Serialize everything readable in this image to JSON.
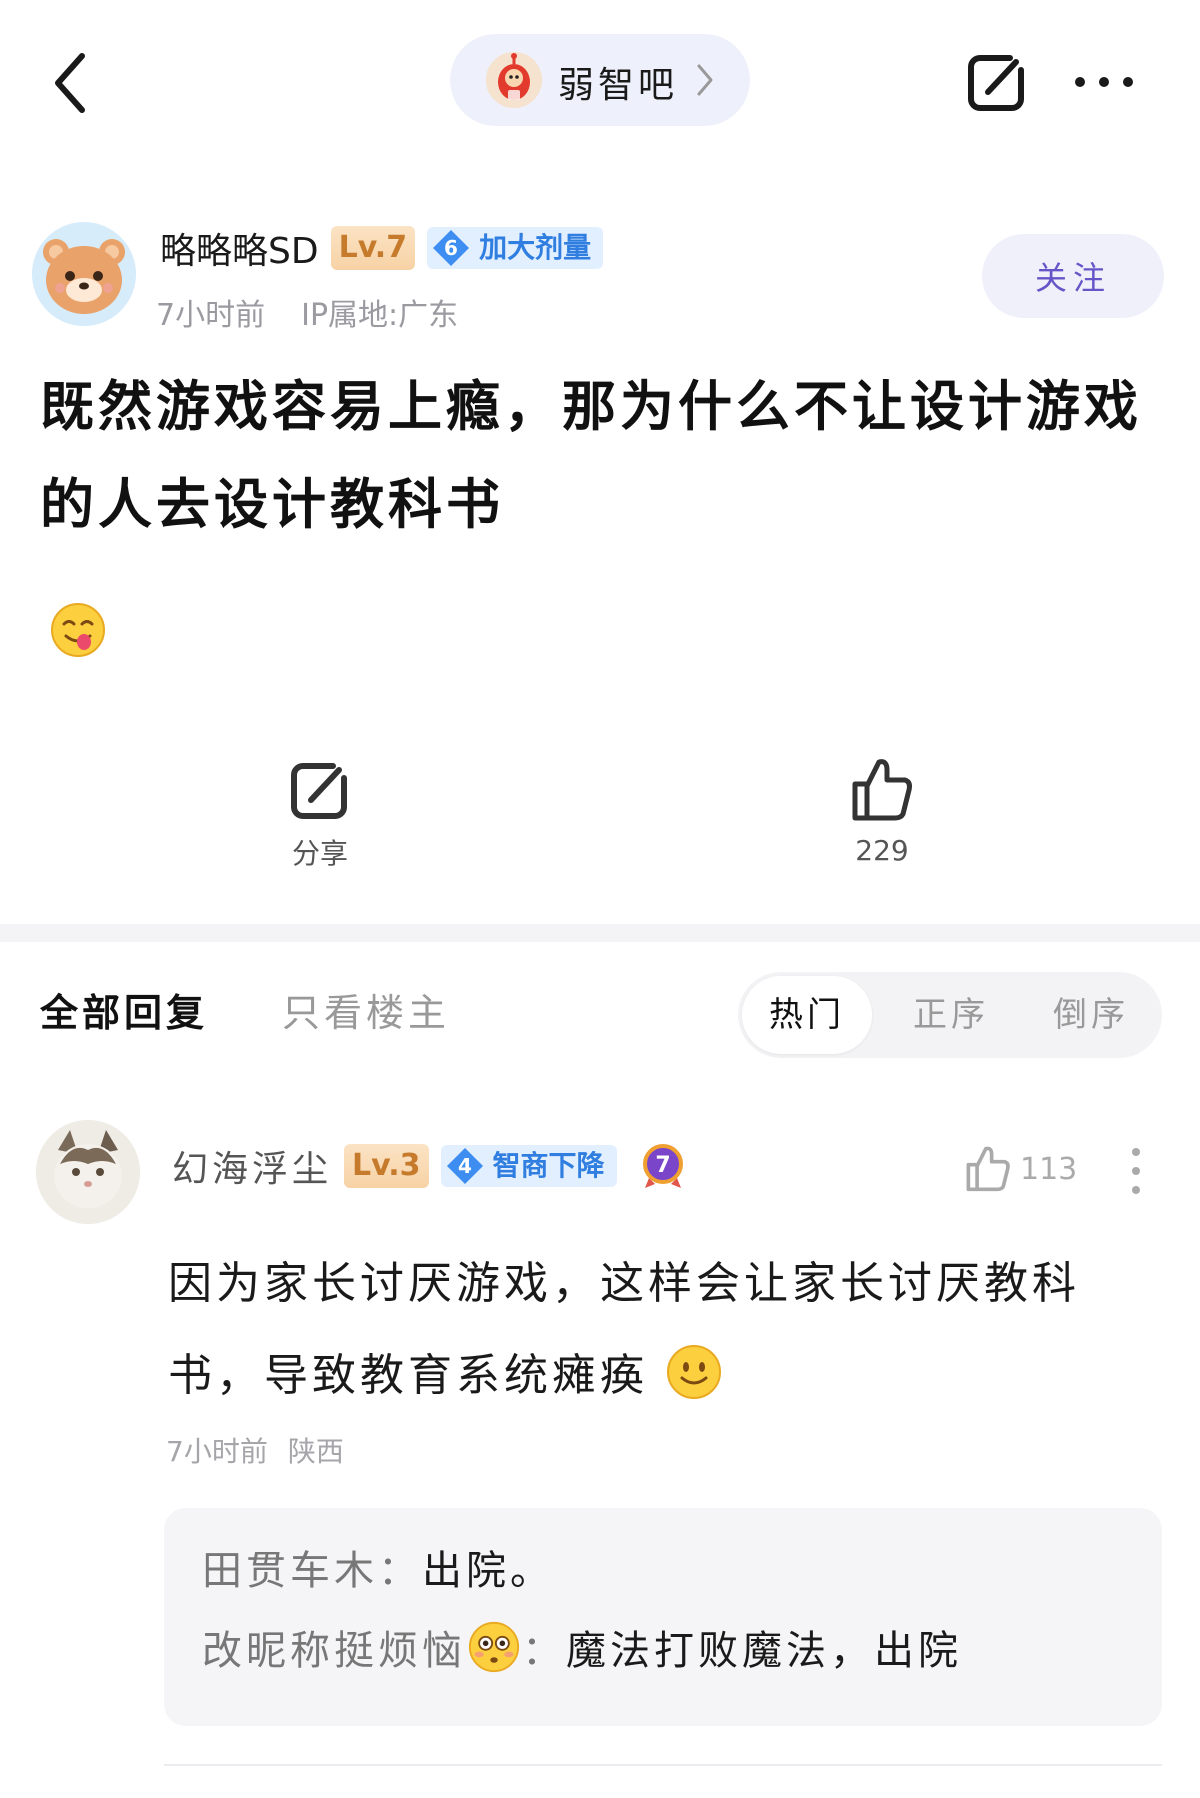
{
  "header": {
    "forum_name": "弱智吧"
  },
  "post": {
    "author": {
      "name": "略略略SD",
      "level": "Lv.7",
      "honor_level": "6",
      "honor_title": "加大剂量",
      "time": "7小时前",
      "ip": "IP属地:广东"
    },
    "follow_label": "关注",
    "title": "既然游戏容易上瘾，那为什么不让设计游戏的人去设计教科书",
    "share_label": "分享",
    "like_count": "229"
  },
  "tabs": {
    "all": "全部回复",
    "op_only": "只看楼主",
    "sort": [
      "热门",
      "正序",
      "倒序"
    ]
  },
  "comment": {
    "name": "幻海浮尘",
    "level": "Lv.3",
    "honor_level": "4",
    "honor_title": "智商下降",
    "extra_badge": "7",
    "like_count": "113",
    "text": "因为家长讨厌游戏，这样会让家长讨厌教科书，导致教育系统瘫痪",
    "time": "7小时前",
    "location": "陕西",
    "replies": [
      {
        "user": "田贯车木",
        "sep": "：",
        "text": "出院。"
      },
      {
        "user": "改昵称挺烦恼",
        "sep": "：",
        "text": "魔法打败魔法，出院"
      }
    ]
  }
}
